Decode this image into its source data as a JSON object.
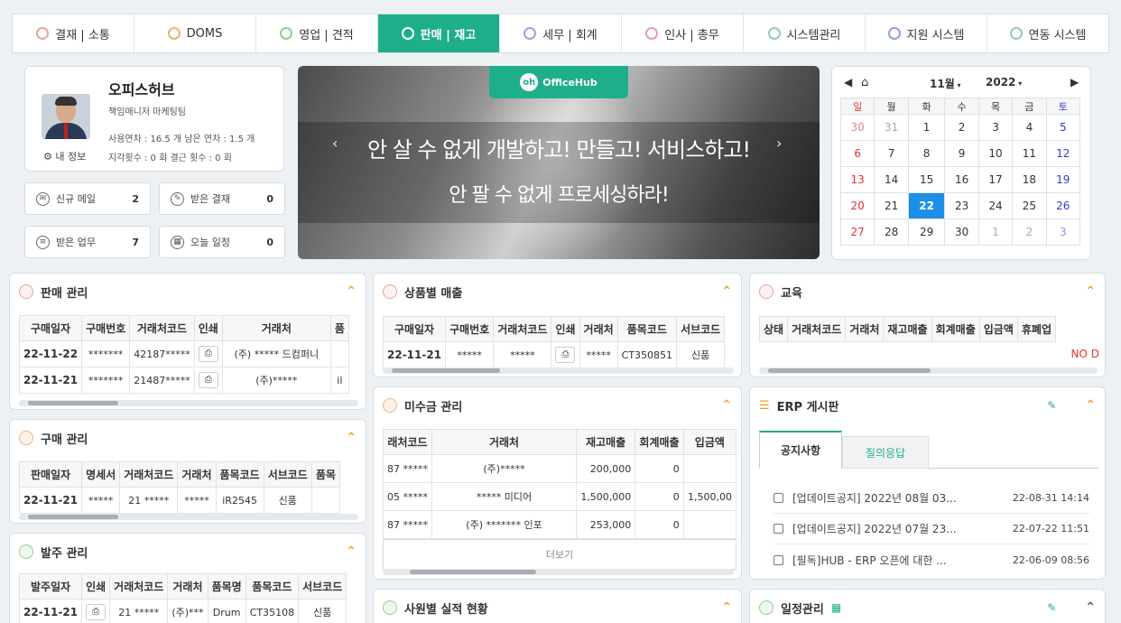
{
  "tabs": [
    {
      "label": "결재 | 소통",
      "icon": "chat-icon",
      "active": false
    },
    {
      "label": "DOMS",
      "icon": "doms-icon",
      "active": false
    },
    {
      "label": "영업 | 견적",
      "icon": "sales-icon",
      "active": false
    },
    {
      "label": "판매 | 재고",
      "icon": "cart-icon",
      "active": true
    },
    {
      "label": "세무 | 회계",
      "icon": "won-icon",
      "active": false
    },
    {
      "label": "인사 | 총무",
      "icon": "person-icon",
      "active": false
    },
    {
      "label": "시스템관리",
      "icon": "monitor-icon",
      "active": false
    },
    {
      "label": "지원 시스템",
      "icon": "support-icon",
      "active": false
    },
    {
      "label": "연동 시스템",
      "icon": "link-icon",
      "active": false
    }
  ],
  "profile": {
    "name": "오피스허브",
    "role": "책임매니저  마케팅팀",
    "leave": "사용연차 : 16.5 개  남은 연차 : 1.5 개",
    "late": "지각횟수 : 0 회  결근 횟수 : 0 회",
    "my_info": "내 정보"
  },
  "quick": [
    {
      "label": "신규 메일",
      "count": "2",
      "icon": "mail-icon"
    },
    {
      "label": "받은 결재",
      "count": "0",
      "icon": "pen-icon"
    },
    {
      "label": "받은 업무",
      "count": "7",
      "icon": "task-icon"
    },
    {
      "label": "오늘 일정",
      "count": "0",
      "icon": "calendar-icon"
    }
  ],
  "banner": {
    "logo": "OfficeHub",
    "line1": "안 살 수 없게 개발하고! 만들고! 서비스하고!",
    "line2": "안 팔 수 없게 프로세싱하라!"
  },
  "calendar": {
    "month": "11월",
    "year": "2022",
    "weekdays": [
      "일",
      "월",
      "화",
      "수",
      "목",
      "금",
      "토"
    ],
    "weeks": [
      [
        "30",
        "31",
        "1",
        "2",
        "3",
        "4",
        "5"
      ],
      [
        "6",
        "7",
        "8",
        "9",
        "10",
        "11",
        "12"
      ],
      [
        "13",
        "14",
        "15",
        "16",
        "17",
        "18",
        "19"
      ],
      [
        "20",
        "21",
        "22",
        "23",
        "24",
        "25",
        "26"
      ],
      [
        "27",
        "28",
        "29",
        "30",
        "1",
        "2",
        "3"
      ]
    ],
    "today": "22"
  },
  "sales": {
    "title": "판매 관리",
    "headers": [
      "구매일자",
      "구매번호",
      "거래처코드",
      "인쇄",
      "거래처",
      "품"
    ],
    "rows": [
      [
        "22-11-22",
        "*******",
        "42187*****",
        "print",
        "(주) ***** 드컴퍼니",
        ""
      ],
      [
        "22-11-21",
        "*******",
        "21487*****",
        "print",
        "(주)*****",
        "il"
      ]
    ]
  },
  "purchase": {
    "title": "구매 관리",
    "headers": [
      "판매일자",
      "명세서",
      "거래처코드",
      "거래처",
      "품목코드",
      "서브코드",
      "품목"
    ],
    "rows": [
      [
        "22-11-21",
        "*****",
        "21 *****",
        "*****",
        "iR2545",
        "신품",
        ""
      ]
    ]
  },
  "order": {
    "title": "발주 관리",
    "headers": [
      "발주일자",
      "인쇄",
      "거래처코드",
      "거래처",
      "품목명",
      "품목코드",
      "서브코드"
    ],
    "rows": [
      [
        "22-11-21",
        "print",
        "21 *****",
        "(주)***",
        "Drum",
        "CT35108",
        "신품"
      ]
    ]
  },
  "product_sales": {
    "title": "상품별 매출",
    "headers": [
      "구매일자",
      "구매번호",
      "거래처코드",
      "인쇄",
      "거래처",
      "품목코드",
      "서브코드"
    ],
    "rows": [
      [
        "22-11-21",
        "*****",
        "*****",
        "print",
        "*****",
        "CT350851",
        "신품"
      ]
    ]
  },
  "receivable": {
    "title": "미수금 관리",
    "headers": [
      "래처코드",
      "거래처",
      "재고매출",
      "회계매출",
      "입금액"
    ],
    "rows": [
      [
        "87 *****",
        "(주)*****",
        "200,000",
        "0",
        ""
      ],
      [
        "05 *****",
        "***** 미디어",
        "1,500,000",
        "0",
        "1,500,00"
      ],
      [
        "87 *****",
        "(주) ******* 인포",
        "253,000",
        "0",
        ""
      ]
    ],
    "more": "더보기"
  },
  "staff": {
    "title": "사원별 실적 현황"
  },
  "education": {
    "title": "교육",
    "headers": [
      "상태",
      "거래처코드",
      "거래처",
      "재고매출",
      "회계매출",
      "입금액",
      "휴폐업"
    ],
    "nod": "NO D"
  },
  "board": {
    "title": "ERP 게시판",
    "tab_notice": "공지사항",
    "tab_qna": "질의응답",
    "posts": [
      {
        "title": "[업데이트공지] 2022년 08월 03...",
        "date": "22-08-31 14:14"
      },
      {
        "title": "[업데이트공지] 2022년 07월 23...",
        "date": "22-07-22 11:51"
      },
      {
        "title": "[필독]HUB - ERP 오픈에 대한 ...",
        "date": "22-06-09 08:56"
      }
    ]
  },
  "schedule": {
    "title": "일정관리"
  },
  "colors": {
    "accent": "#1fae8a",
    "today": "#1e8fe6",
    "caret": "#f0a020"
  }
}
